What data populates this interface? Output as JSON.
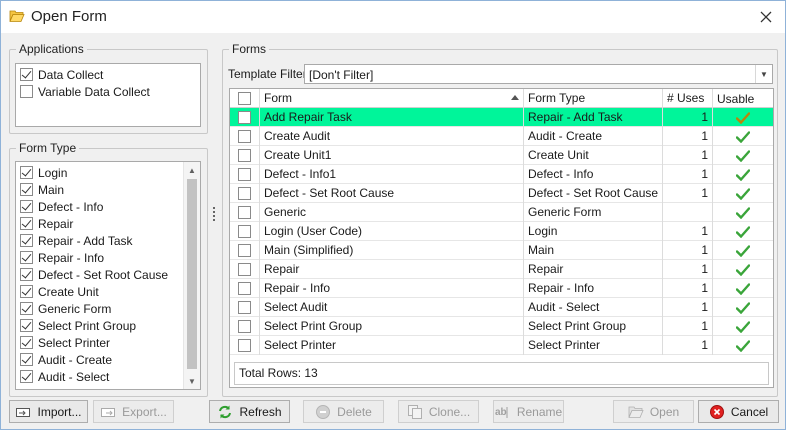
{
  "window": {
    "title": "Open Form",
    "icon": "folder-open-icon"
  },
  "applications": {
    "legend": "Applications",
    "items": [
      {
        "label": "Data Collect",
        "checked": true
      },
      {
        "label": "Variable Data Collect",
        "checked": false
      }
    ]
  },
  "form_type": {
    "legend": "Form Type",
    "items": [
      {
        "label": "Login",
        "checked": true
      },
      {
        "label": "Main",
        "checked": true
      },
      {
        "label": "Defect - Info",
        "checked": true
      },
      {
        "label": "Repair",
        "checked": true
      },
      {
        "label": "Repair - Add Task",
        "checked": true
      },
      {
        "label": "Repair - Info",
        "checked": true
      },
      {
        "label": "Defect - Set Root Cause",
        "checked": true
      },
      {
        "label": "Create Unit",
        "checked": true
      },
      {
        "label": "Generic Form",
        "checked": true
      },
      {
        "label": "Select Print Group",
        "checked": true
      },
      {
        "label": "Select Printer",
        "checked": true
      },
      {
        "label": "Audit - Create",
        "checked": true
      },
      {
        "label": "Audit - Select",
        "checked": true
      }
    ]
  },
  "forms": {
    "legend": "Forms",
    "template_filter_label": "Template Filter",
    "template_filter_value": "[Don't Filter]",
    "columns": {
      "form": "Form",
      "form_type": "Form Type",
      "uses": "# Uses",
      "usable": "Usable"
    },
    "selected_color": "#00f59a",
    "rows": [
      {
        "form": "Add Repair Task",
        "form_type": "Repair - Add Task",
        "uses": "1",
        "usable": true,
        "selected": true
      },
      {
        "form": "Create Audit",
        "form_type": "Audit - Create",
        "uses": "1",
        "usable": true
      },
      {
        "form": "Create Unit1",
        "form_type": "Create Unit",
        "uses": "1",
        "usable": true
      },
      {
        "form": "Defect - Info1",
        "form_type": "Defect - Info",
        "uses": "1",
        "usable": true
      },
      {
        "form": "Defect - Set Root Cause",
        "form_type": "Defect - Set Root Cause",
        "uses": "1",
        "usable": true
      },
      {
        "form": "Generic",
        "form_type": "Generic Form",
        "uses": "",
        "usable": true
      },
      {
        "form": "Login (User Code)",
        "form_type": "Login",
        "uses": "1",
        "usable": true
      },
      {
        "form": "Main (Simplified)",
        "form_type": "Main",
        "uses": "1",
        "usable": true
      },
      {
        "form": "Repair",
        "form_type": "Repair",
        "uses": "1",
        "usable": true
      },
      {
        "form": "Repair - Info",
        "form_type": "Repair - Info",
        "uses": "1",
        "usable": true
      },
      {
        "form": "Select Audit",
        "form_type": "Audit - Select",
        "uses": "1",
        "usable": true
      },
      {
        "form": "Select Print Group",
        "form_type": "Select Print Group",
        "uses": "1",
        "usable": true
      },
      {
        "form": "Select Printer",
        "form_type": "Select Printer",
        "uses": "1",
        "usable": true
      }
    ],
    "total_rows": "Total Rows: 13"
  },
  "buttons": {
    "import": "Import...",
    "export": "Export...",
    "refresh": "Refresh",
    "delete": "Delete",
    "clone": "Clone...",
    "rename": "Rename",
    "open": "Open",
    "cancel": "Cancel"
  }
}
